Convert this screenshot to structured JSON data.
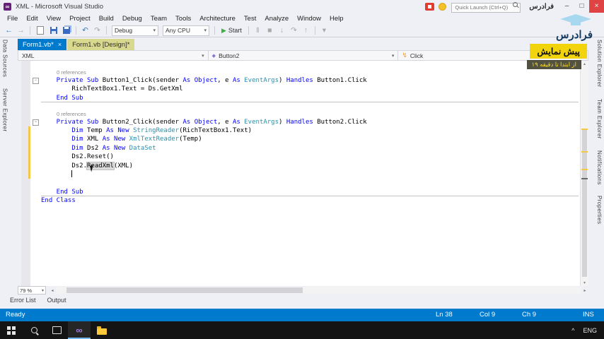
{
  "colors": {
    "accent": "#007acc",
    "keyword": "#0000ff",
    "type_name": "#2b91af",
    "change_bar": "#f2c84b",
    "banner_yellow": "#f2d40d",
    "inactive_tab_tint": "#d8d88f",
    "taskbar_bg": "#141414"
  },
  "window": {
    "title": "XML - Microsoft Visual Studio",
    "quick_launch_placeholder": "Quick Launch (Ctrl+Q)",
    "brand_text": "فرادرس",
    "minimize": "–",
    "maximize": "□",
    "close": "×"
  },
  "menus": [
    "File",
    "Edit",
    "View",
    "Project",
    "Build",
    "Debug",
    "Team",
    "Tools",
    "Architecture",
    "Test",
    "Analyze",
    "Window",
    "Help"
  ],
  "toolbar": {
    "config": "Debug",
    "platform": "Any CPU",
    "start": "Start"
  },
  "icons": {
    "back": "←",
    "forward": "→",
    "undo": "↶",
    "redo": "↷",
    "play": "▶",
    "pause": "‖",
    "stop": "■",
    "step_into": "↓",
    "step_over": "↷",
    "step_out": "↑",
    "chevron": "▾",
    "left": "◂",
    "right": "▸",
    "up": "▴",
    "down": "▾",
    "collapse": "−",
    "event": "↯",
    "method": "◆",
    "tray_caret": "˄"
  },
  "doc_tabs": [
    {
      "label": "Form1.vb*",
      "close": "×",
      "active": true
    },
    {
      "label": "Form1.vb [Design]*",
      "active": false
    }
  ],
  "navbar": {
    "project": "XML",
    "object": "Button2",
    "event": "Click"
  },
  "left_panel_tabs": [
    "Data Sources",
    "Server Explorer"
  ],
  "right_panel_tabs": [
    "Solution Explorer",
    "Team Explorer",
    "Notifications",
    "Properties"
  ],
  "code": {
    "lines": [
      {
        "kind": "blank"
      },
      {
        "kind": "codelens",
        "text": "0 references"
      },
      {
        "kind": "code",
        "collapse": true,
        "segs": [
          [
            "kw",
            "    Private Sub "
          ],
          [
            "txt",
            "Button1_Click(sender "
          ],
          [
            "kw",
            "As Object"
          ],
          [
            "txt",
            ", e "
          ],
          [
            "kw",
            "As "
          ],
          [
            "typ",
            "EventArgs"
          ],
          [
            "txt",
            ") "
          ],
          [
            "kw",
            "Handles "
          ],
          [
            "txt",
            "Button1.Click"
          ]
        ]
      },
      {
        "kind": "code",
        "segs": [
          [
            "txt",
            "        RichTextBox1.Text = Ds.GetXml"
          ]
        ]
      },
      {
        "kind": "code",
        "sep": true,
        "segs": [
          [
            "kw",
            "    End Sub"
          ]
        ]
      },
      {
        "kind": "blank"
      },
      {
        "kind": "codelens",
        "text": "0 references"
      },
      {
        "kind": "code",
        "collapse": true,
        "segs": [
          [
            "kw",
            "    Private Sub "
          ],
          [
            "txt",
            "Button2_Click(sender "
          ],
          [
            "kw",
            "As Object"
          ],
          [
            "txt",
            ", e "
          ],
          [
            "kw",
            "As "
          ],
          [
            "typ",
            "EventArgs"
          ],
          [
            "txt",
            ") "
          ],
          [
            "kw",
            "Handles "
          ],
          [
            "txt",
            "Button2.Click"
          ]
        ]
      },
      {
        "kind": "code",
        "changed": true,
        "segs": [
          [
            "kw",
            "        Dim "
          ],
          [
            "txt",
            "Temp "
          ],
          [
            "kw",
            "As New "
          ],
          [
            "typ",
            "StringReader"
          ],
          [
            "txt",
            "(RichTextBox1.Text)"
          ]
        ]
      },
      {
        "kind": "code",
        "changed": true,
        "segs": [
          [
            "kw",
            "        Dim "
          ],
          [
            "txt",
            "XML "
          ],
          [
            "kw",
            "As New "
          ],
          [
            "typ",
            "XmlTextReader"
          ],
          [
            "txt",
            "(Temp)"
          ]
        ]
      },
      {
        "kind": "code",
        "changed": true,
        "segs": [
          [
            "kw",
            "        Dim "
          ],
          [
            "txt",
            "Ds2 "
          ],
          [
            "kw",
            "As New "
          ],
          [
            "typ",
            "DataSet"
          ]
        ]
      },
      {
        "kind": "code",
        "changed": true,
        "segs": [
          [
            "txt",
            "        Ds2.Reset()"
          ]
        ]
      },
      {
        "kind": "code",
        "changed": true,
        "segs": [
          [
            "txt",
            "        Ds2."
          ],
          [
            "hl",
            "ReadXml"
          ],
          [
            "txt",
            "(XML)"
          ]
        ]
      },
      {
        "kind": "code",
        "changed": true,
        "caret": true,
        "segs": [
          [
            "txt",
            "        "
          ]
        ]
      },
      {
        "kind": "blank"
      },
      {
        "kind": "code",
        "sep": true,
        "segs": [
          [
            "kw",
            "    End Sub"
          ]
        ]
      },
      {
        "kind": "code",
        "segs": [
          [
            "kw",
            "End Class"
          ]
        ]
      }
    ]
  },
  "editor_bottom": {
    "zoom": "79 %"
  },
  "panel_tabs": [
    "Error List",
    "Output"
  ],
  "status": {
    "state": "Ready",
    "line": "Ln 38",
    "column": "Col 9",
    "character": "Ch 9",
    "mode": "INS"
  },
  "taskbar": {
    "language": "ENG",
    "tray_expand": "^"
  },
  "overlay": {
    "preview_label": "پیش نمایش",
    "range_label": "از ابتدا تا دقیقه ۱۹",
    "brand": "فرادرس"
  }
}
